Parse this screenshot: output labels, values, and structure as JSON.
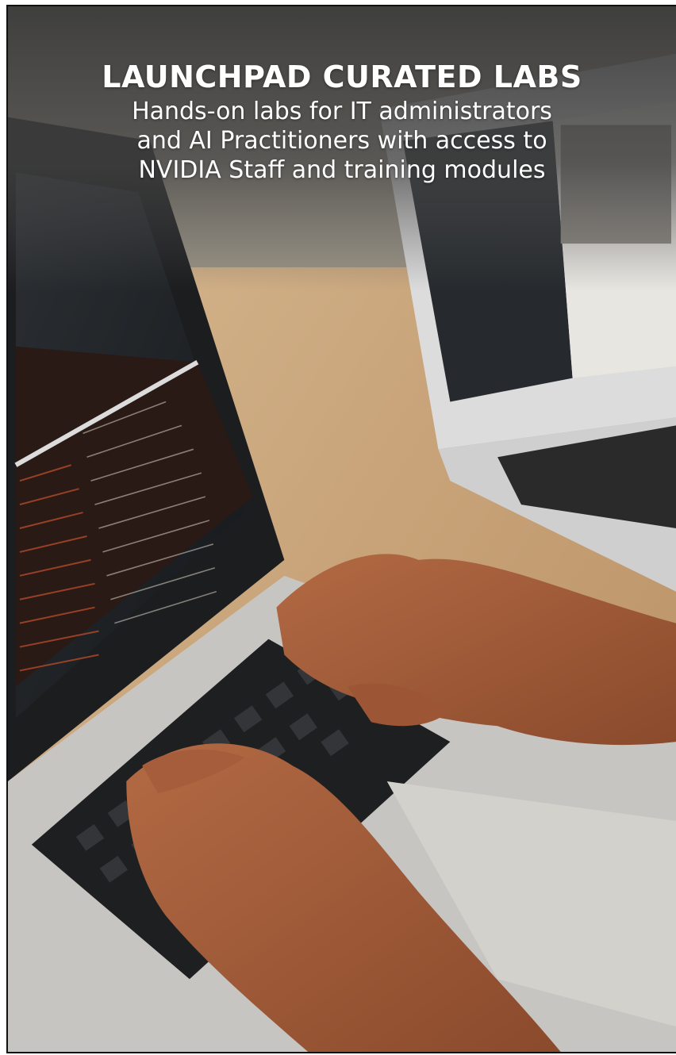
{
  "hero": {
    "title": "LAUNCHPAD CURATED LABS",
    "subtitle_lines": [
      "Hands-on labs for IT administrators",
      "and AI Practitioners with access to",
      "NVIDIA Staff and training modules"
    ]
  },
  "image": {
    "subject_icon": "laptop-typing-photo",
    "colors": {
      "desk": "#c9a97f",
      "overlay": "#4a4a4a",
      "text": "#ffffff"
    }
  }
}
